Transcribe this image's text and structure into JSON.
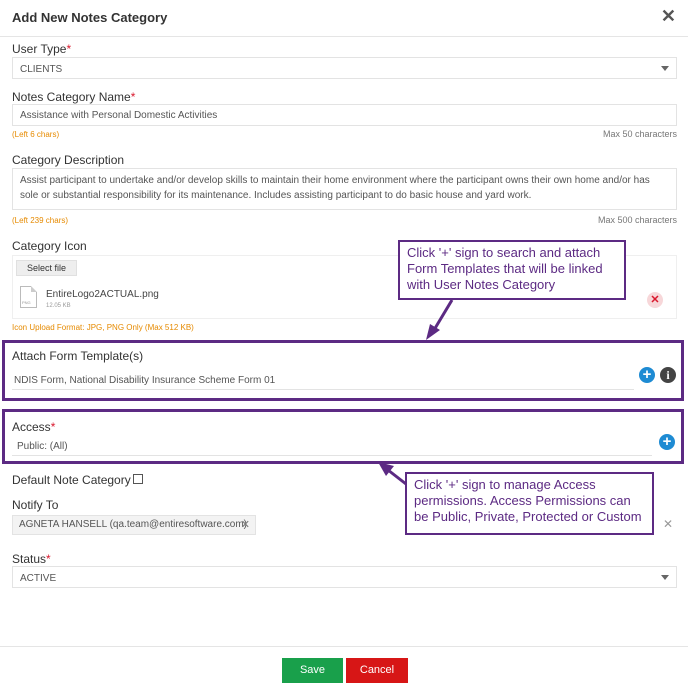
{
  "modal": {
    "title": "Add New Notes Category",
    "close": "✕"
  },
  "user_type": {
    "label": "User Type",
    "required": "*",
    "value": "CLIENTS"
  },
  "category_name": {
    "label": "Notes Category Name",
    "required": "*",
    "value": "Assistance with Personal Domestic Activities",
    "left_hint": "(Left 6 chars)",
    "max_hint": "Max 50 characters"
  },
  "description": {
    "label": "Category Description",
    "value": "Assist participant to undertake and/or develop skills to maintain their home environment where the participant owns their own home and/or has sole or substantial responsibility for its maintenance. Includes assisting participant to do basic house and yard work.",
    "left_hint": "(Left 239 chars)",
    "max_hint": "Max 500 characters"
  },
  "category_icon": {
    "label": "Category Icon",
    "select_file": "Select file",
    "file_name": "EntireLogo2ACTUAL.png",
    "file_size": "12.05 KB",
    "file_ext": "PNG",
    "remove": "✕",
    "format_hint": "Icon Upload Format: JPG, PNG Only (Max 512 KB)"
  },
  "form_template": {
    "label": "Attach Form Template(s)",
    "value": "NDIS Form, National Disability Insurance Scheme Form 01",
    "add": "+",
    "info": "i"
  },
  "access": {
    "label": "Access",
    "required": "*",
    "value": "Public: (All)",
    "add": "+"
  },
  "default_note": {
    "label": "Default Note Category"
  },
  "notify_to": {
    "label": "Notify To",
    "tag": "AGNETA HANSELL (qa.team@entiresoftware.com)",
    "tag_remove": "✕",
    "clear": "✕"
  },
  "status": {
    "label": "Status",
    "required": "*",
    "value": "ACTIVE"
  },
  "callouts": {
    "template": "Click '+' sign to search and attach Form Templates that will be linked with User Notes Category",
    "access": "Click '+' sign to manage Access permissions. Access Permissions can be Public, Private, Protected or Custom"
  },
  "footer": {
    "save": "Save",
    "cancel": "Cancel"
  },
  "colors": {
    "highlight": "#5c2a83",
    "save": "#19a04b",
    "cancel": "#d71616",
    "add_icon": "#1e8bd3",
    "required": "#d9182d",
    "hint": "#e68a00"
  }
}
